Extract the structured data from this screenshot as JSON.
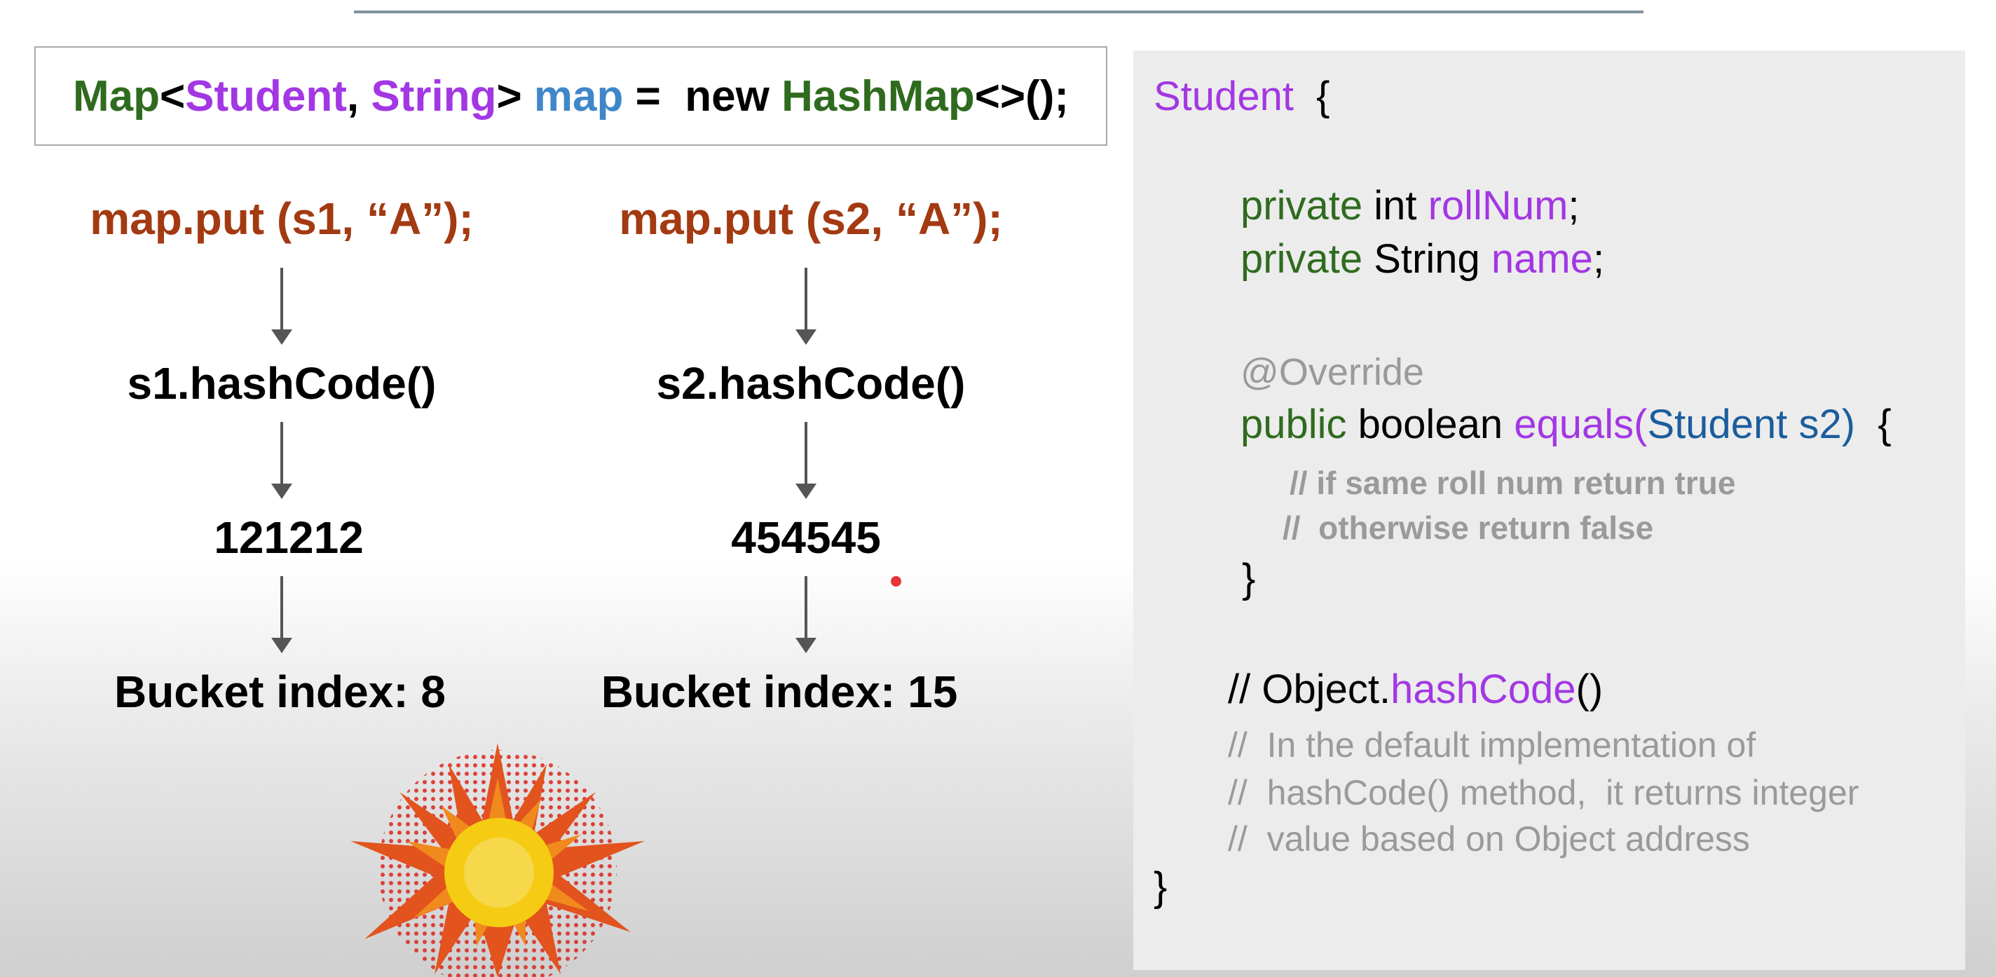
{
  "declaration": {
    "map": "Map",
    "lt": "<",
    "student": "Student",
    "comma": ", ",
    "string": "String",
    "gt": "> ",
    "var": "map",
    "eq": " =  new ",
    "hashmap": "HashMap",
    "tail": "<>();"
  },
  "left_flow": {
    "put": "map.put (s1, “A”);",
    "hash_call": "s1.hashCode()",
    "hash_value": "121212",
    "bucket": "Bucket index: 8"
  },
  "right_flow": {
    "put": "map.put (s2, “A”);",
    "hash_call": "s2.hashCode()",
    "hash_value": "454545",
    "bucket": "Bucket index: 15"
  },
  "code": {
    "class_name": "Student",
    "open_brace": "  {",
    "field1": {
      "mod": "private",
      "type": " int ",
      "name": "rollNum",
      "end": ";"
    },
    "field2": {
      "mod": "private",
      "type": " String ",
      "name": "name",
      "end": ";"
    },
    "annotation": "@Override",
    "method": {
      "mod": "public",
      "type": " boolean ",
      "name": "equals",
      "paren": "(",
      "param": "Student s2)",
      "brace": "  {"
    },
    "comment1": "// if same roll num return true",
    "comment2": "//  otherwise return false",
    "method_close": "}",
    "obj_prefix": "// Object.",
    "obj_method": "hashCode",
    "obj_parens": "()",
    "doc1": "//  In the default implementation of",
    "doc2": "//  hashCode() method,  it returns integer",
    "doc3": "//  value based on Object address",
    "class_close": "}"
  },
  "colors": {
    "keyword_green": "#2f6b1f",
    "identifier_purple": "#a237e3",
    "variable_blue": "#3f87c9",
    "put_red": "#a33a12",
    "comment_gray": "#9a9a9a"
  }
}
